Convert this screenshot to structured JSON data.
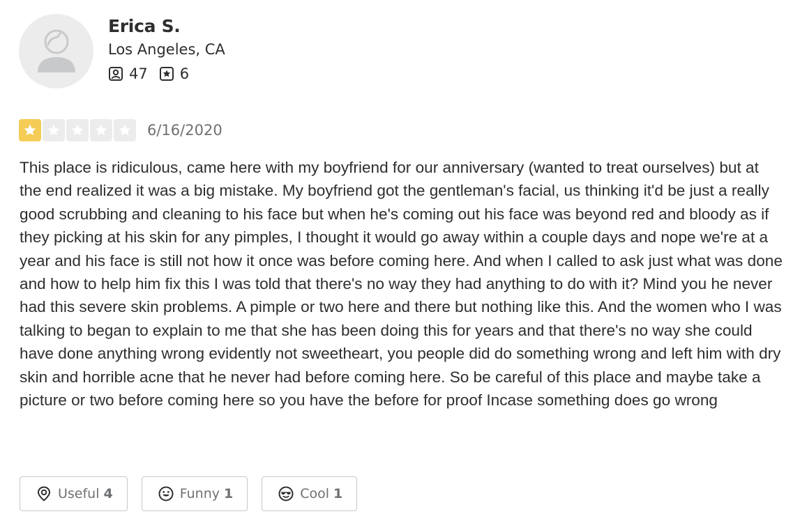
{
  "user": {
    "name": "Erica S.",
    "location": "Los Angeles, CA",
    "friends_count": "47",
    "reviews_count": "6",
    "avatar_icon": "default-user-avatar-icon"
  },
  "review": {
    "rating": 1,
    "max_rating": 5,
    "date": "6/16/2020",
    "text": "This place is ridiculous, came here with my boyfriend for our anniversary (wanted to treat ourselves) but at the end realized it was a big mistake. My boyfriend got the gentleman's facial, us thinking it'd be just a really good scrubbing and cleaning to his face but when he's coming out his face was beyond red and bloody as if they picking at his skin for any pimples, I thought it would go away within a couple days and nope we're at a year and his face is still not how it once was before coming here. And when I called to ask just what was done and how to help him fix this I was told that there's no way they had anything to do with it? Mind you he never had this severe skin problems. A pimple or two here and there but nothing like this. And the women who I was talking to began to explain to me that she has been doing this for years and that there's no way she could have done anything wrong evidently not sweetheart, you people did do something wrong and left him with dry skin and horrible acne that he never had before coming here. So be careful of this place and maybe take a picture or two before coming here so you have the before for proof Incase something does go wrong"
  },
  "reactions": {
    "useful": {
      "label": "Useful",
      "count": "4",
      "icon": "lightbulb-icon"
    },
    "funny": {
      "label": "Funny",
      "count": "1",
      "icon": "smile-icon"
    },
    "cool": {
      "label": "Cool",
      "count": "1",
      "icon": "sunglasses-icon"
    }
  },
  "colors": {
    "star_filled": "#f4cc56",
    "star_empty": "#ececec",
    "text": "#2d2e2f",
    "muted": "#6e7072",
    "border": "#c8c9ca"
  }
}
